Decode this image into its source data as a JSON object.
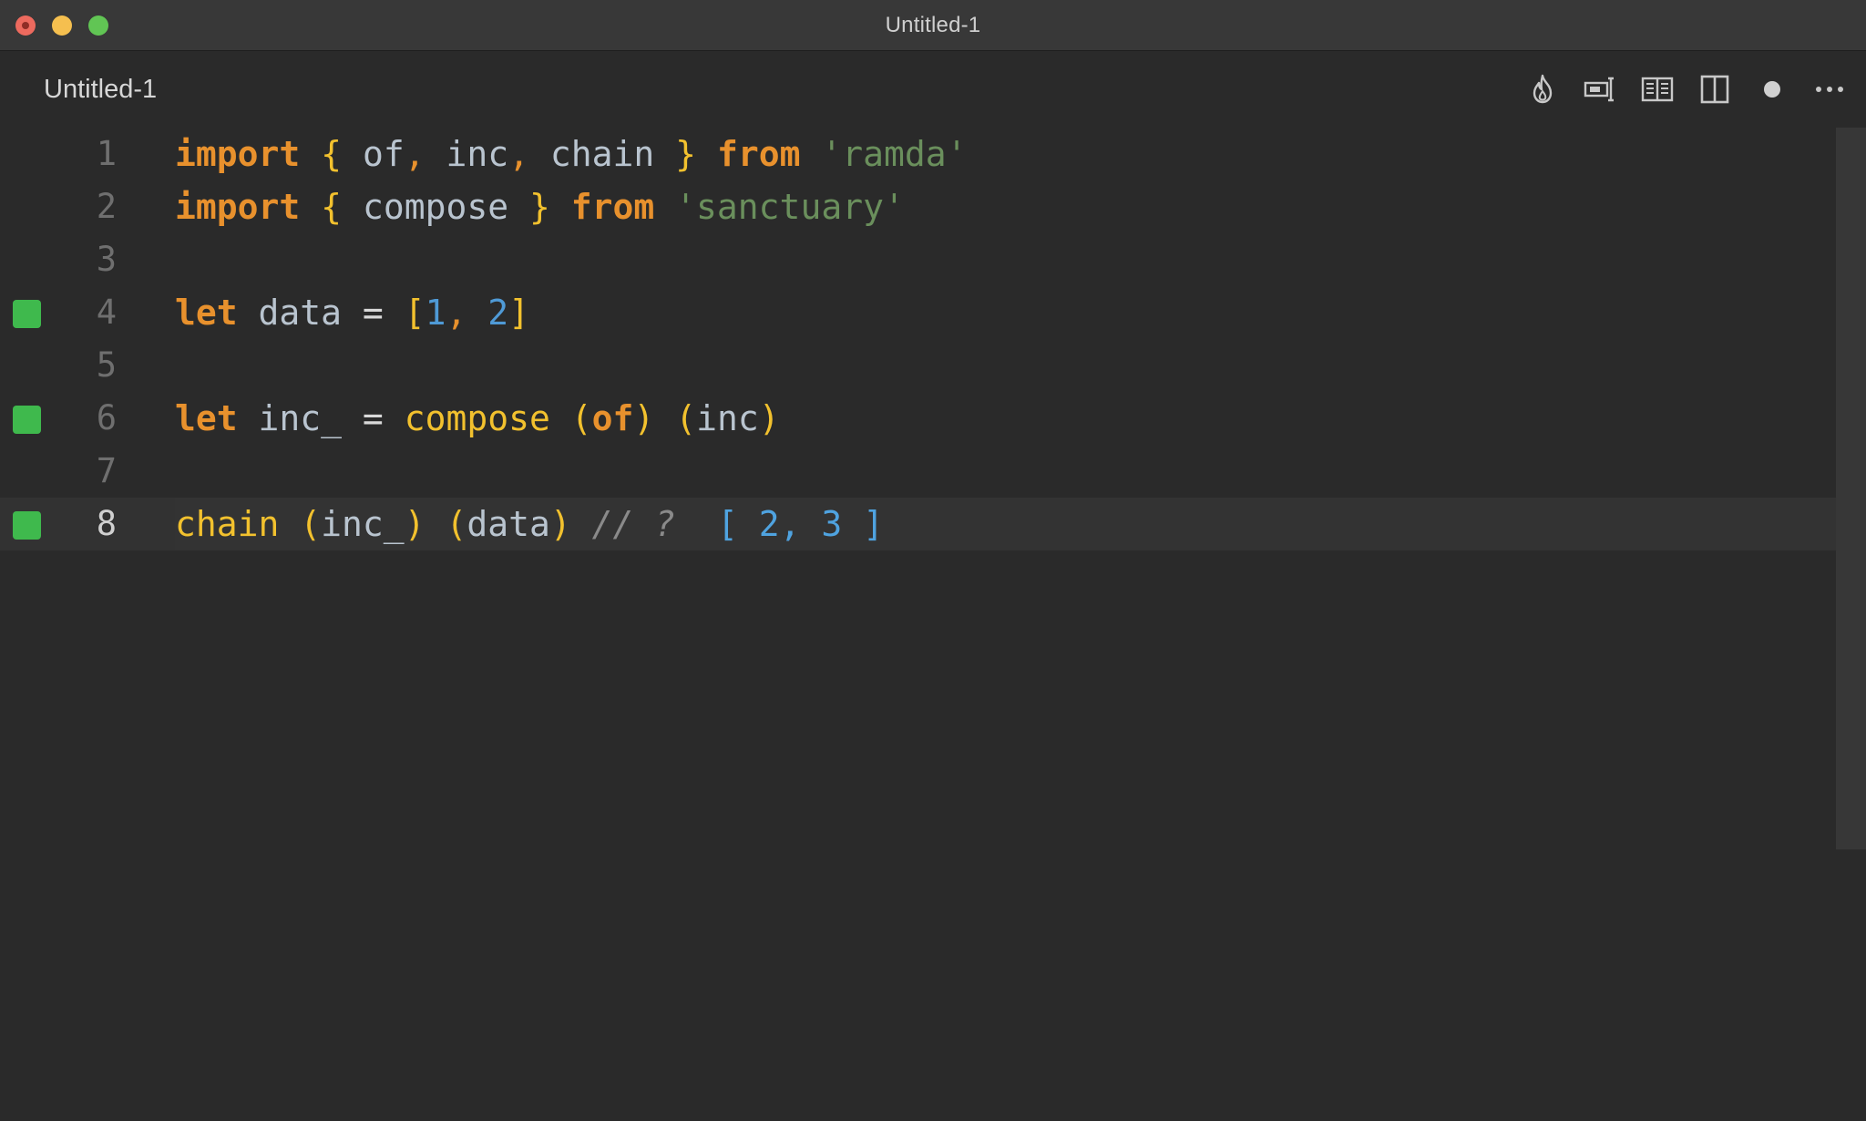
{
  "window": {
    "title": "Untitled-1"
  },
  "tab": {
    "label": "Untitled-1"
  },
  "tab_actions": [
    {
      "icon": "flame-icon"
    },
    {
      "icon": "toggle-panel-icon"
    },
    {
      "icon": "open-preview-icon"
    },
    {
      "icon": "split-editor-icon"
    },
    {
      "icon": "unsaved-dot-icon"
    },
    {
      "icon": "more-actions-icon"
    }
  ],
  "editor": {
    "current_line": 8,
    "lines": [
      {
        "number": "1",
        "covered": false
      },
      {
        "number": "2",
        "covered": false
      },
      {
        "number": "3",
        "covered": false
      },
      {
        "number": "4",
        "covered": true
      },
      {
        "number": "5",
        "covered": false
      },
      {
        "number": "6",
        "covered": true
      },
      {
        "number": "7",
        "covered": false
      },
      {
        "number": "8",
        "covered": true
      }
    ],
    "tokens": {
      "l1": [
        "import",
        " ",
        "{",
        " of",
        ",",
        " inc",
        ",",
        " chain",
        " ",
        "}",
        " ",
        "from",
        " ",
        "'ramda'"
      ],
      "l2": [
        "import",
        " ",
        "{",
        " compose",
        " ",
        "}",
        " ",
        "from",
        " ",
        "'sanctuary'"
      ],
      "l4": [
        "let",
        " data",
        " ",
        "=",
        " ",
        "[",
        "1",
        ",",
        " ",
        "2",
        "]"
      ],
      "l6": [
        "let",
        " inc_",
        " ",
        "=",
        " ",
        "compose",
        " ",
        "(",
        "of",
        ")",
        " ",
        "(",
        "inc",
        ")"
      ],
      "l8": [
        "chain",
        " ",
        "(",
        "inc_",
        ")",
        " ",
        "(",
        "data",
        ")",
        " ",
        "// ?",
        "  ",
        "[ 2, 3 ]"
      ]
    }
  },
  "colors": {
    "background": "#2a2a2a",
    "keyword": "#e8912d",
    "bracket": "#f2c12e",
    "string": "#6a8f5c",
    "number": "#4f9ad6",
    "coverage": "#3fb94d"
  }
}
